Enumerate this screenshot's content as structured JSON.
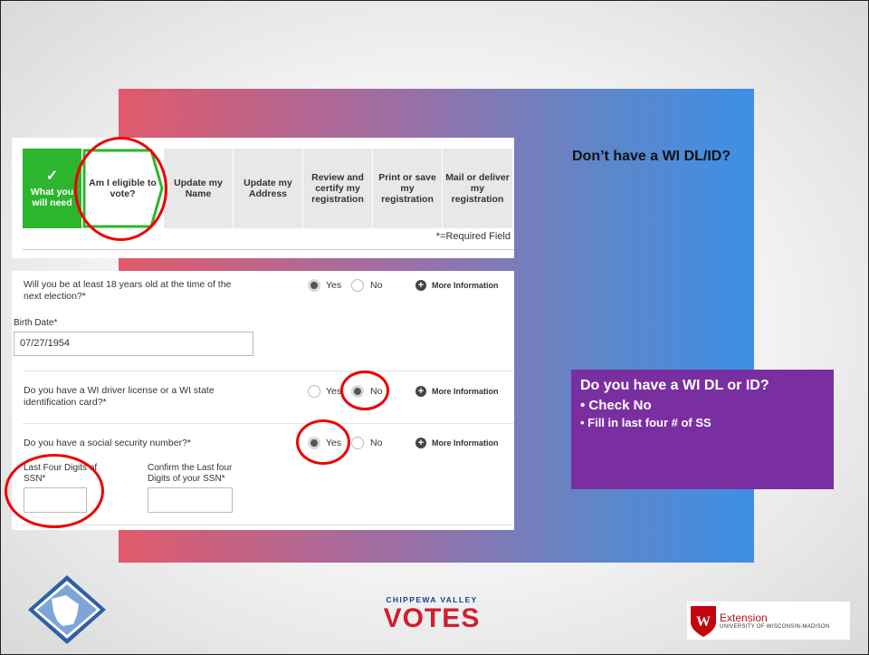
{
  "heading": "Don’t have a WI DL/ID?",
  "steps": {
    "what_you_will_need": "What you will need",
    "eligible": "Am I eligible to vote?",
    "update_name": "Update my Name",
    "update_address": "Update my Address",
    "review": "Review and certify my registration",
    "print": "Print or save my registration",
    "mail": "Mail or deliver my registration",
    "required_field": "*=Required Field"
  },
  "form": {
    "q_age": "Will you be at least 18 years old at the time of the next election?*",
    "age_selected": "Yes",
    "birth_label": "Birth Date*",
    "birth_value": "07/27/1954",
    "q_license": "Do you have a WI driver license or a WI state identification card?*",
    "license_selected": "No",
    "q_ssn": "Do you have a social security number?*",
    "ssn_selected": "Yes",
    "yes": "Yes",
    "no": "No",
    "more_info": "More Information",
    "last4_label": "Last Four Digits of SSN*",
    "confirm_label": "Confirm the Last four Digits of your SSN*"
  },
  "callout": {
    "title": "Do you have a WI DL or ID?",
    "bullets": [
      "Check No",
      "Fill in last four # of SS"
    ]
  },
  "logos": {
    "cv_top": "CHIPPEWA VALLEY",
    "cv_main": "VOTES",
    "ext_name": "Extension",
    "ext_sub": "UNIVERSITY OF WISCONSIN-MADISON"
  },
  "colors": {
    "accent_green": "#2db52d",
    "annotation_red": "#e00000",
    "callout_purple": "#7a2fa0"
  }
}
